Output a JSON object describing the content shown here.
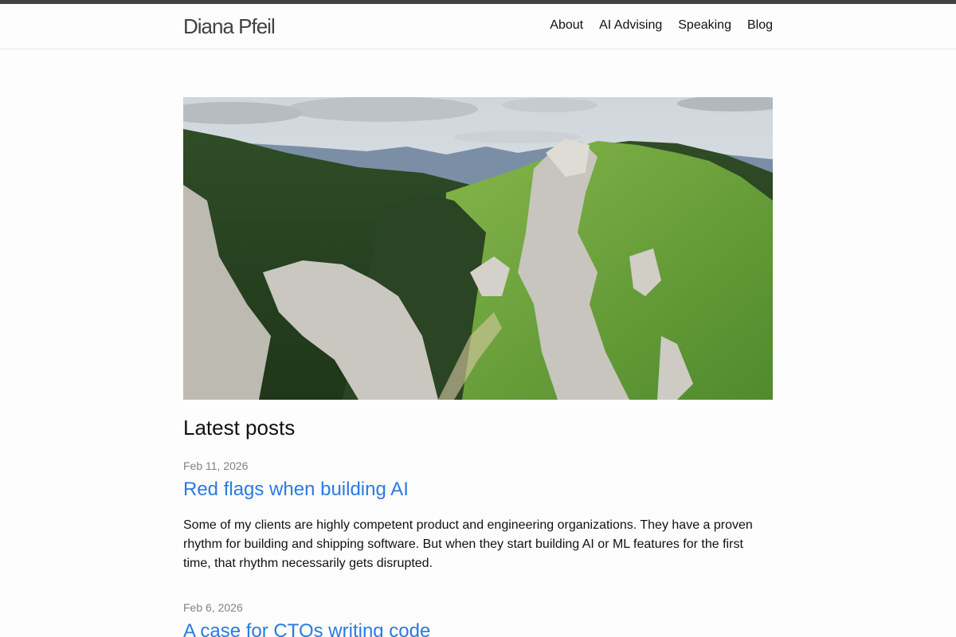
{
  "site": {
    "title": "Diana Pfeil"
  },
  "nav": {
    "items": [
      {
        "label": "About"
      },
      {
        "label": "AI Advising"
      },
      {
        "label": "Speaking"
      },
      {
        "label": "Blog"
      }
    ]
  },
  "hero": {
    "description": "Mountain landscape with rocky ridges and green forests"
  },
  "main": {
    "section_title": "Latest posts",
    "posts": [
      {
        "date": "Feb 11, 2026",
        "title": "Red flags when building AI",
        "excerpt": "Some of my clients are highly competent product and engineering organizations. They have a proven rhythm for building and shipping software. But when they start building AI or ML features for the first time, that rhythm necessarily gets disrupted."
      },
      {
        "date": "Feb 6, 2026",
        "title": "A case for CTOs writing code"
      }
    ]
  },
  "colors": {
    "link": "#2a7ae2",
    "topbar": "#424242",
    "meta": "#828282"
  }
}
